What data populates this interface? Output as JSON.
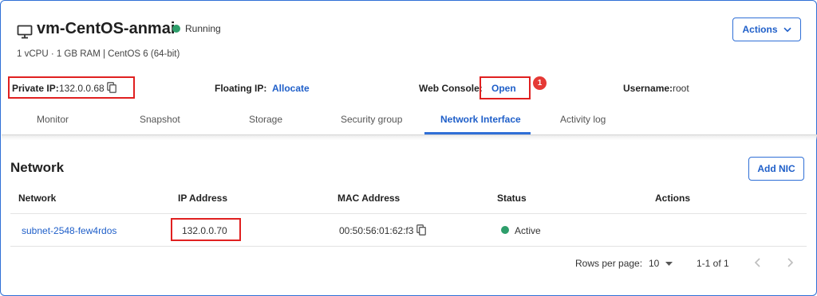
{
  "header": {
    "title": "vm-CentOS-anmai",
    "status": "Running",
    "status_color": "#2e9e6b",
    "specs": "1 vCPU · 1 GB RAM | CentOS 6 (64-bit)",
    "actions_label": "Actions"
  },
  "info": {
    "private_ip_label": "Private IP:",
    "private_ip_value": "132.0.0.68",
    "floating_ip_label": "Floating IP:",
    "floating_ip_action": "Allocate",
    "web_console_label": "Web Console:",
    "web_console_action": "Open",
    "step_badge": "1",
    "username_label": "Username:",
    "username_value": "root"
  },
  "tabs": [
    {
      "label": "Monitor"
    },
    {
      "label": "Snapshot"
    },
    {
      "label": "Storage"
    },
    {
      "label": "Security group"
    },
    {
      "label": "Network Interface",
      "active": true
    },
    {
      "label": "Activity log"
    }
  ],
  "network": {
    "title": "Network",
    "add_label": "Add NIC",
    "columns": [
      "Network",
      "IP Address",
      "MAC Address",
      "Status",
      "Actions"
    ],
    "rows": [
      {
        "network": "subnet-2548-few4rdos",
        "ip": "132.0.0.70",
        "mac": "00:50:56:01:62:f3",
        "status": "Active"
      }
    ],
    "pagination": {
      "rows_per_page_label": "Rows per page:",
      "rows_per_page_value": "10",
      "range": "1-1 of 1"
    }
  },
  "colors": {
    "accent": "#1f5fc9",
    "highlight": "#e02020",
    "badge": "#e53935"
  }
}
